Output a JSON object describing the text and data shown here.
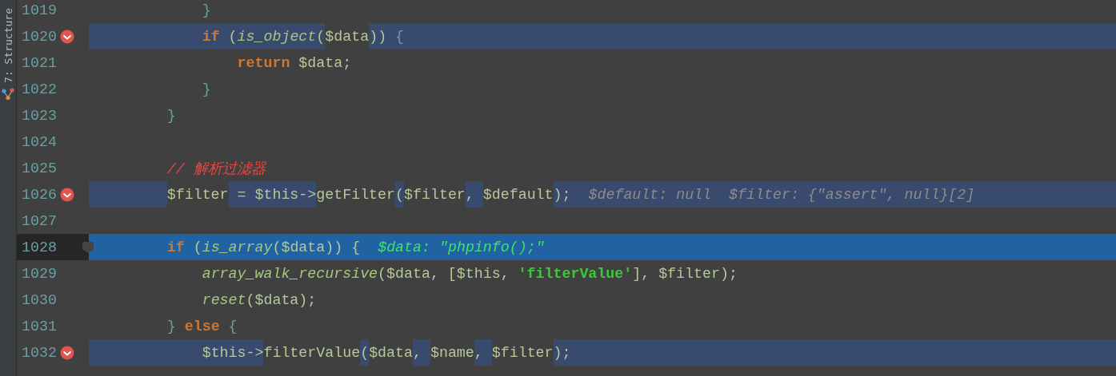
{
  "tool_strip": {
    "label": "7: Structure"
  },
  "lines": [
    {
      "number": "1019",
      "breakpoint": false,
      "current": false,
      "tokens": [
        {
          "kind": "brace",
          "text": "            }"
        }
      ]
    },
    {
      "number": "1020",
      "breakpoint": true,
      "current": false,
      "tokens": [
        {
          "kind": "keyword",
          "text": "            if",
          "highlight": true
        },
        {
          "kind": "punct",
          "text": " (",
          "highlight": true
        },
        {
          "kind": "function",
          "text": "is_object",
          "highlight": true
        },
        {
          "kind": "punct",
          "text": "(",
          "highlight": true
        },
        {
          "kind": "var",
          "text": "$data",
          "highlight": false
        },
        {
          "kind": "punct",
          "text": ")) ",
          "highlight": true
        },
        {
          "kind": "brace",
          "text": "{",
          "highlight": true
        }
      ]
    },
    {
      "number": "1021",
      "breakpoint": false,
      "current": false,
      "tokens": [
        {
          "kind": "keyword",
          "text": "                return"
        },
        {
          "kind": "var",
          "text": " $data;"
        }
      ]
    },
    {
      "number": "1022",
      "breakpoint": false,
      "current": false,
      "tokens": [
        {
          "kind": "brace",
          "text": "            }"
        }
      ]
    },
    {
      "number": "1023",
      "breakpoint": false,
      "current": false,
      "tokens": [
        {
          "kind": "brace",
          "text": "        }"
        }
      ]
    },
    {
      "number": "1024",
      "breakpoint": false,
      "current": false
    },
    {
      "number": "1025",
      "breakpoint": false,
      "current": false,
      "tokens": [
        {
          "kind": "comment",
          "text": "        // 解析过滤器"
        }
      ]
    },
    {
      "number": "1026",
      "breakpoint": true,
      "current": false,
      "tokens": [
        {
          "kind": "var",
          "text": "        $filter",
          "highlight": false
        },
        {
          "kind": "var",
          "text": " = $this->",
          "highlight": true
        },
        {
          "kind": "var",
          "text": "getFilter",
          "highlight": false
        },
        {
          "kind": "punct",
          "text": "(",
          "highlight": true
        },
        {
          "kind": "var",
          "text": "$filter",
          "highlight": false
        },
        {
          "kind": "var",
          "text": ", ",
          "highlight": true
        },
        {
          "kind": "var",
          "text": "$default",
          "highlight": false
        },
        {
          "kind": "var",
          "text": ");",
          "highlight": true
        },
        {
          "kind": "hint",
          "text": "$default: null",
          "highlight": true
        },
        {
          "kind": "hint",
          "text": "$filter: {\"assert\", null}[2]",
          "highlight": true
        }
      ]
    },
    {
      "number": "1027",
      "breakpoint": false,
      "current": false
    },
    {
      "number": "1028",
      "breakpoint": false,
      "current": true,
      "tokens": [
        {
          "kind": "keyword",
          "text": "        if"
        },
        {
          "kind": "punct",
          "text": " ("
        },
        {
          "kind": "function",
          "text": "is_array"
        },
        {
          "kind": "var",
          "text": "($data)) {"
        },
        {
          "kind": "hint",
          "text": "$data: \"phpinfo();\""
        }
      ]
    },
    {
      "number": "1029",
      "breakpoint": false,
      "current": false,
      "tokens": [
        {
          "kind": "function",
          "text": "            array_walk_recursive"
        },
        {
          "kind": "var",
          "text": "($data, [$this, "
        },
        {
          "kind": "string",
          "text": "'filterValue'"
        },
        {
          "kind": "var",
          "text": "], $filter);"
        }
      ]
    },
    {
      "number": "1030",
      "breakpoint": false,
      "current": false,
      "tokens": [
        {
          "kind": "function",
          "text": "            reset"
        },
        {
          "kind": "var",
          "text": "($data);"
        }
      ]
    },
    {
      "number": "1031",
      "breakpoint": false,
      "current": false,
      "tokens": [
        {
          "kind": "brace",
          "text": "        } "
        },
        {
          "kind": "keyword",
          "text": "else"
        },
        {
          "kind": "brace",
          "text": " {"
        }
      ]
    },
    {
      "number": "1032",
      "breakpoint": true,
      "current": false,
      "tokens": [
        {
          "kind": "var",
          "text": "            $this->",
          "highlight": true
        },
        {
          "kind": "var",
          "text": "filterValue",
          "highlight": false
        },
        {
          "kind": "punct",
          "text": "(",
          "highlight": true
        },
        {
          "kind": "var",
          "text": "$data",
          "highlight": false
        },
        {
          "kind": "var",
          "text": ", ",
          "highlight": true
        },
        {
          "kind": "var",
          "text": "$name",
          "highlight": false
        },
        {
          "kind": "var",
          "text": ", ",
          "highlight": true
        },
        {
          "kind": "var",
          "text": "$filter",
          "highlight": false
        },
        {
          "kind": "var",
          "text": ");",
          "highlight": true
        }
      ]
    }
  ]
}
